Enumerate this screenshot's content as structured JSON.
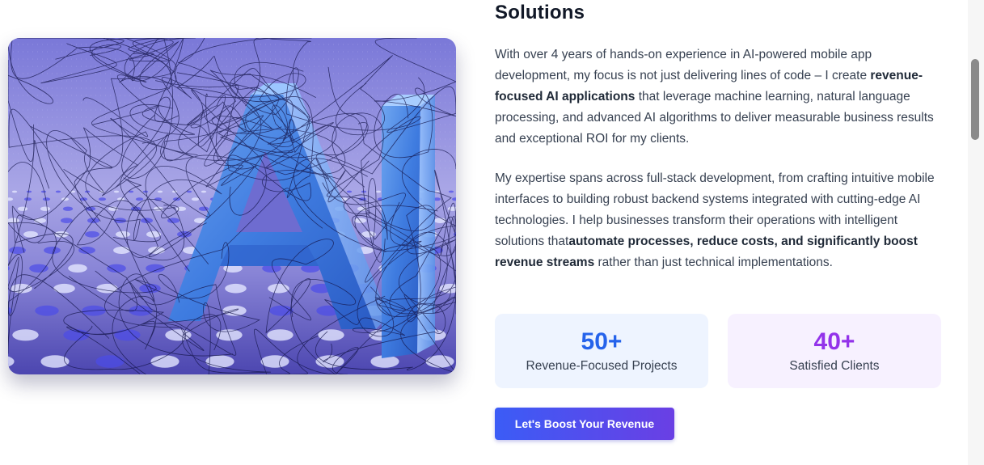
{
  "section": {
    "title": "Solutions"
  },
  "paragraphs": {
    "p1": [
      {
        "text": "With over 4 years of hands-on experience in AI-powered mobile app development, my focus is not just delivering lines of code – I create ",
        "bold": false
      },
      {
        "text": "revenue-focused AI applications",
        "bold": true
      },
      {
        "text": " that leverage machine learning, natural language processing, and advanced AI algorithms to deliver measurable business results and exceptional ROI for my clients.",
        "bold": false
      }
    ],
    "p2": [
      {
        "text": "My expertise spans across full-stack development, from crafting intuitive mobile interfaces to building robust backend systems integrated with cutting-edge AI technologies. I help businesses transform their operations with intelligent solutions that",
        "bold": false
      },
      {
        "text": "automate processes, reduce costs, and significantly boost revenue streams",
        "bold": true
      },
      {
        "text": " rather than just technical implementations.",
        "bold": false
      }
    ]
  },
  "stats": {
    "projects": {
      "value": "50+",
      "label": "Revenue-Focused Projects",
      "color": "#2563eb"
    },
    "clients": {
      "value": "40+",
      "label": "Satisfied Clients",
      "color": "#9333ea"
    }
  },
  "cta": {
    "label": "Let's Boost Your Revenue"
  },
  "image": {
    "lettering": "AI"
  },
  "colors": {
    "accent_blue": "#3b5cf6",
    "accent_purple": "#6a3fe4",
    "card_blue_bg": "#eef4ff",
    "card_purple_bg": "#f7f1ff"
  }
}
